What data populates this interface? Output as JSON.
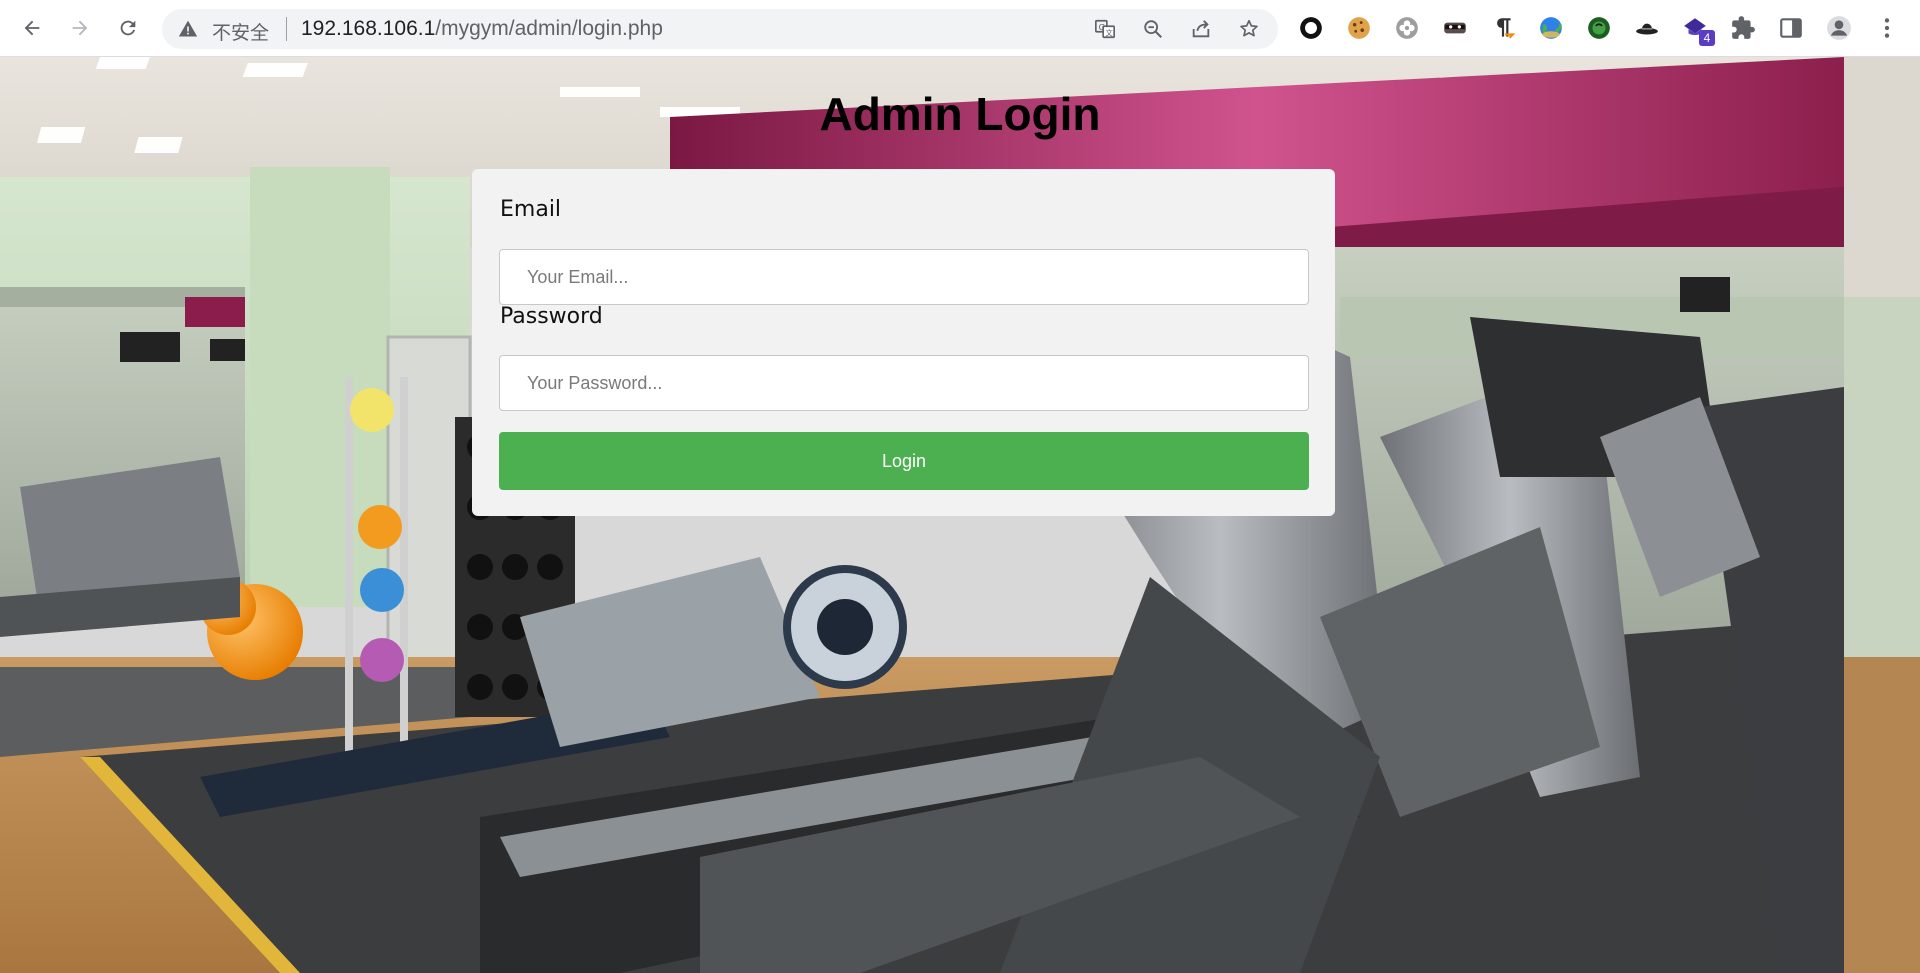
{
  "browser": {
    "security_label": "不安全",
    "url_host": "192.168.106.1",
    "url_path": "/mygym/admin/login.php",
    "extensions": [
      {
        "name": "circle-extension-icon"
      },
      {
        "name": "cookie-extension-icon"
      },
      {
        "name": "flower-extension-icon"
      },
      {
        "name": "mask-extension-icon"
      },
      {
        "name": "pilcrow-extension-icon"
      },
      {
        "name": "globe-extension-icon"
      },
      {
        "name": "green-orb-extension-icon"
      },
      {
        "name": "hat-extension-icon"
      },
      {
        "name": "cap-extension-icon",
        "badge": "4"
      }
    ]
  },
  "page": {
    "title": "Admin Login",
    "form": {
      "email_label": "Email",
      "email_placeholder": "Your Email...",
      "password_label": "Password",
      "password_placeholder": "Your Password...",
      "submit_label": "Login"
    }
  },
  "colors": {
    "button": "#4caf50",
    "card": "#f2f2f2"
  }
}
